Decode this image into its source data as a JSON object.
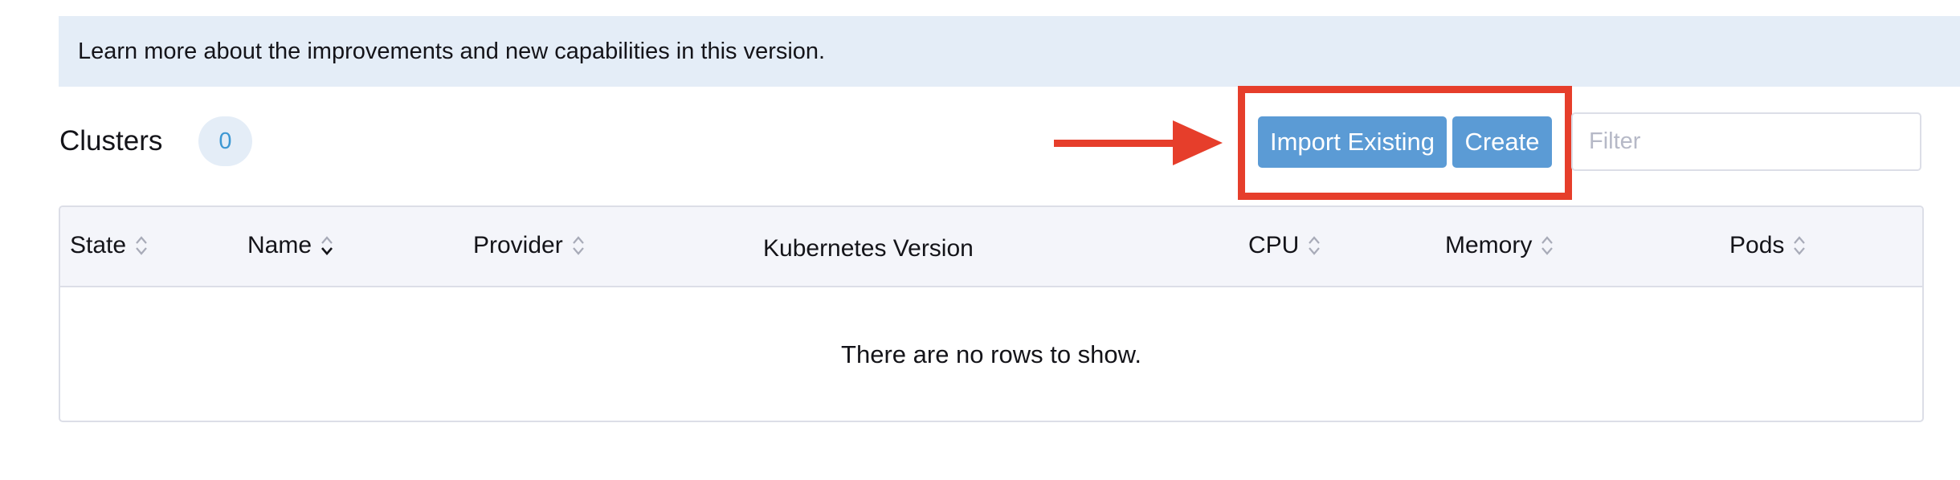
{
  "banner": {
    "text": "Learn more about the improvements and new capabilities in this version."
  },
  "header": {
    "title": "Clusters",
    "count": "0"
  },
  "toolbar": {
    "import_label": "Import Existing",
    "create_label": "Create",
    "filter_placeholder": "Filter",
    "filter_value": ""
  },
  "table": {
    "columns": [
      {
        "label": "State",
        "sortable": true,
        "sort_state": "none"
      },
      {
        "label": "Name",
        "sortable": true,
        "sort_state": "sorted"
      },
      {
        "label": "Provider",
        "sortable": true,
        "sort_state": "none"
      },
      {
        "label": "Kubernetes Version",
        "sortable": false
      },
      {
        "label": "CPU",
        "sortable": true,
        "sort_state": "none"
      },
      {
        "label": "Memory",
        "sortable": true,
        "sort_state": "none"
      },
      {
        "label": "Pods",
        "sortable": true,
        "sort_state": "none"
      }
    ],
    "empty_text": "There are no rows to show."
  },
  "annotation": {
    "arrow_icon": "arrow-right-icon",
    "highlight_color": "#e63e2b"
  },
  "colors": {
    "banner_bg": "#e4edf7",
    "button_bg": "#5b9bd5",
    "badge_text": "#3d98d3",
    "table_header_bg": "#f4f5fa"
  }
}
